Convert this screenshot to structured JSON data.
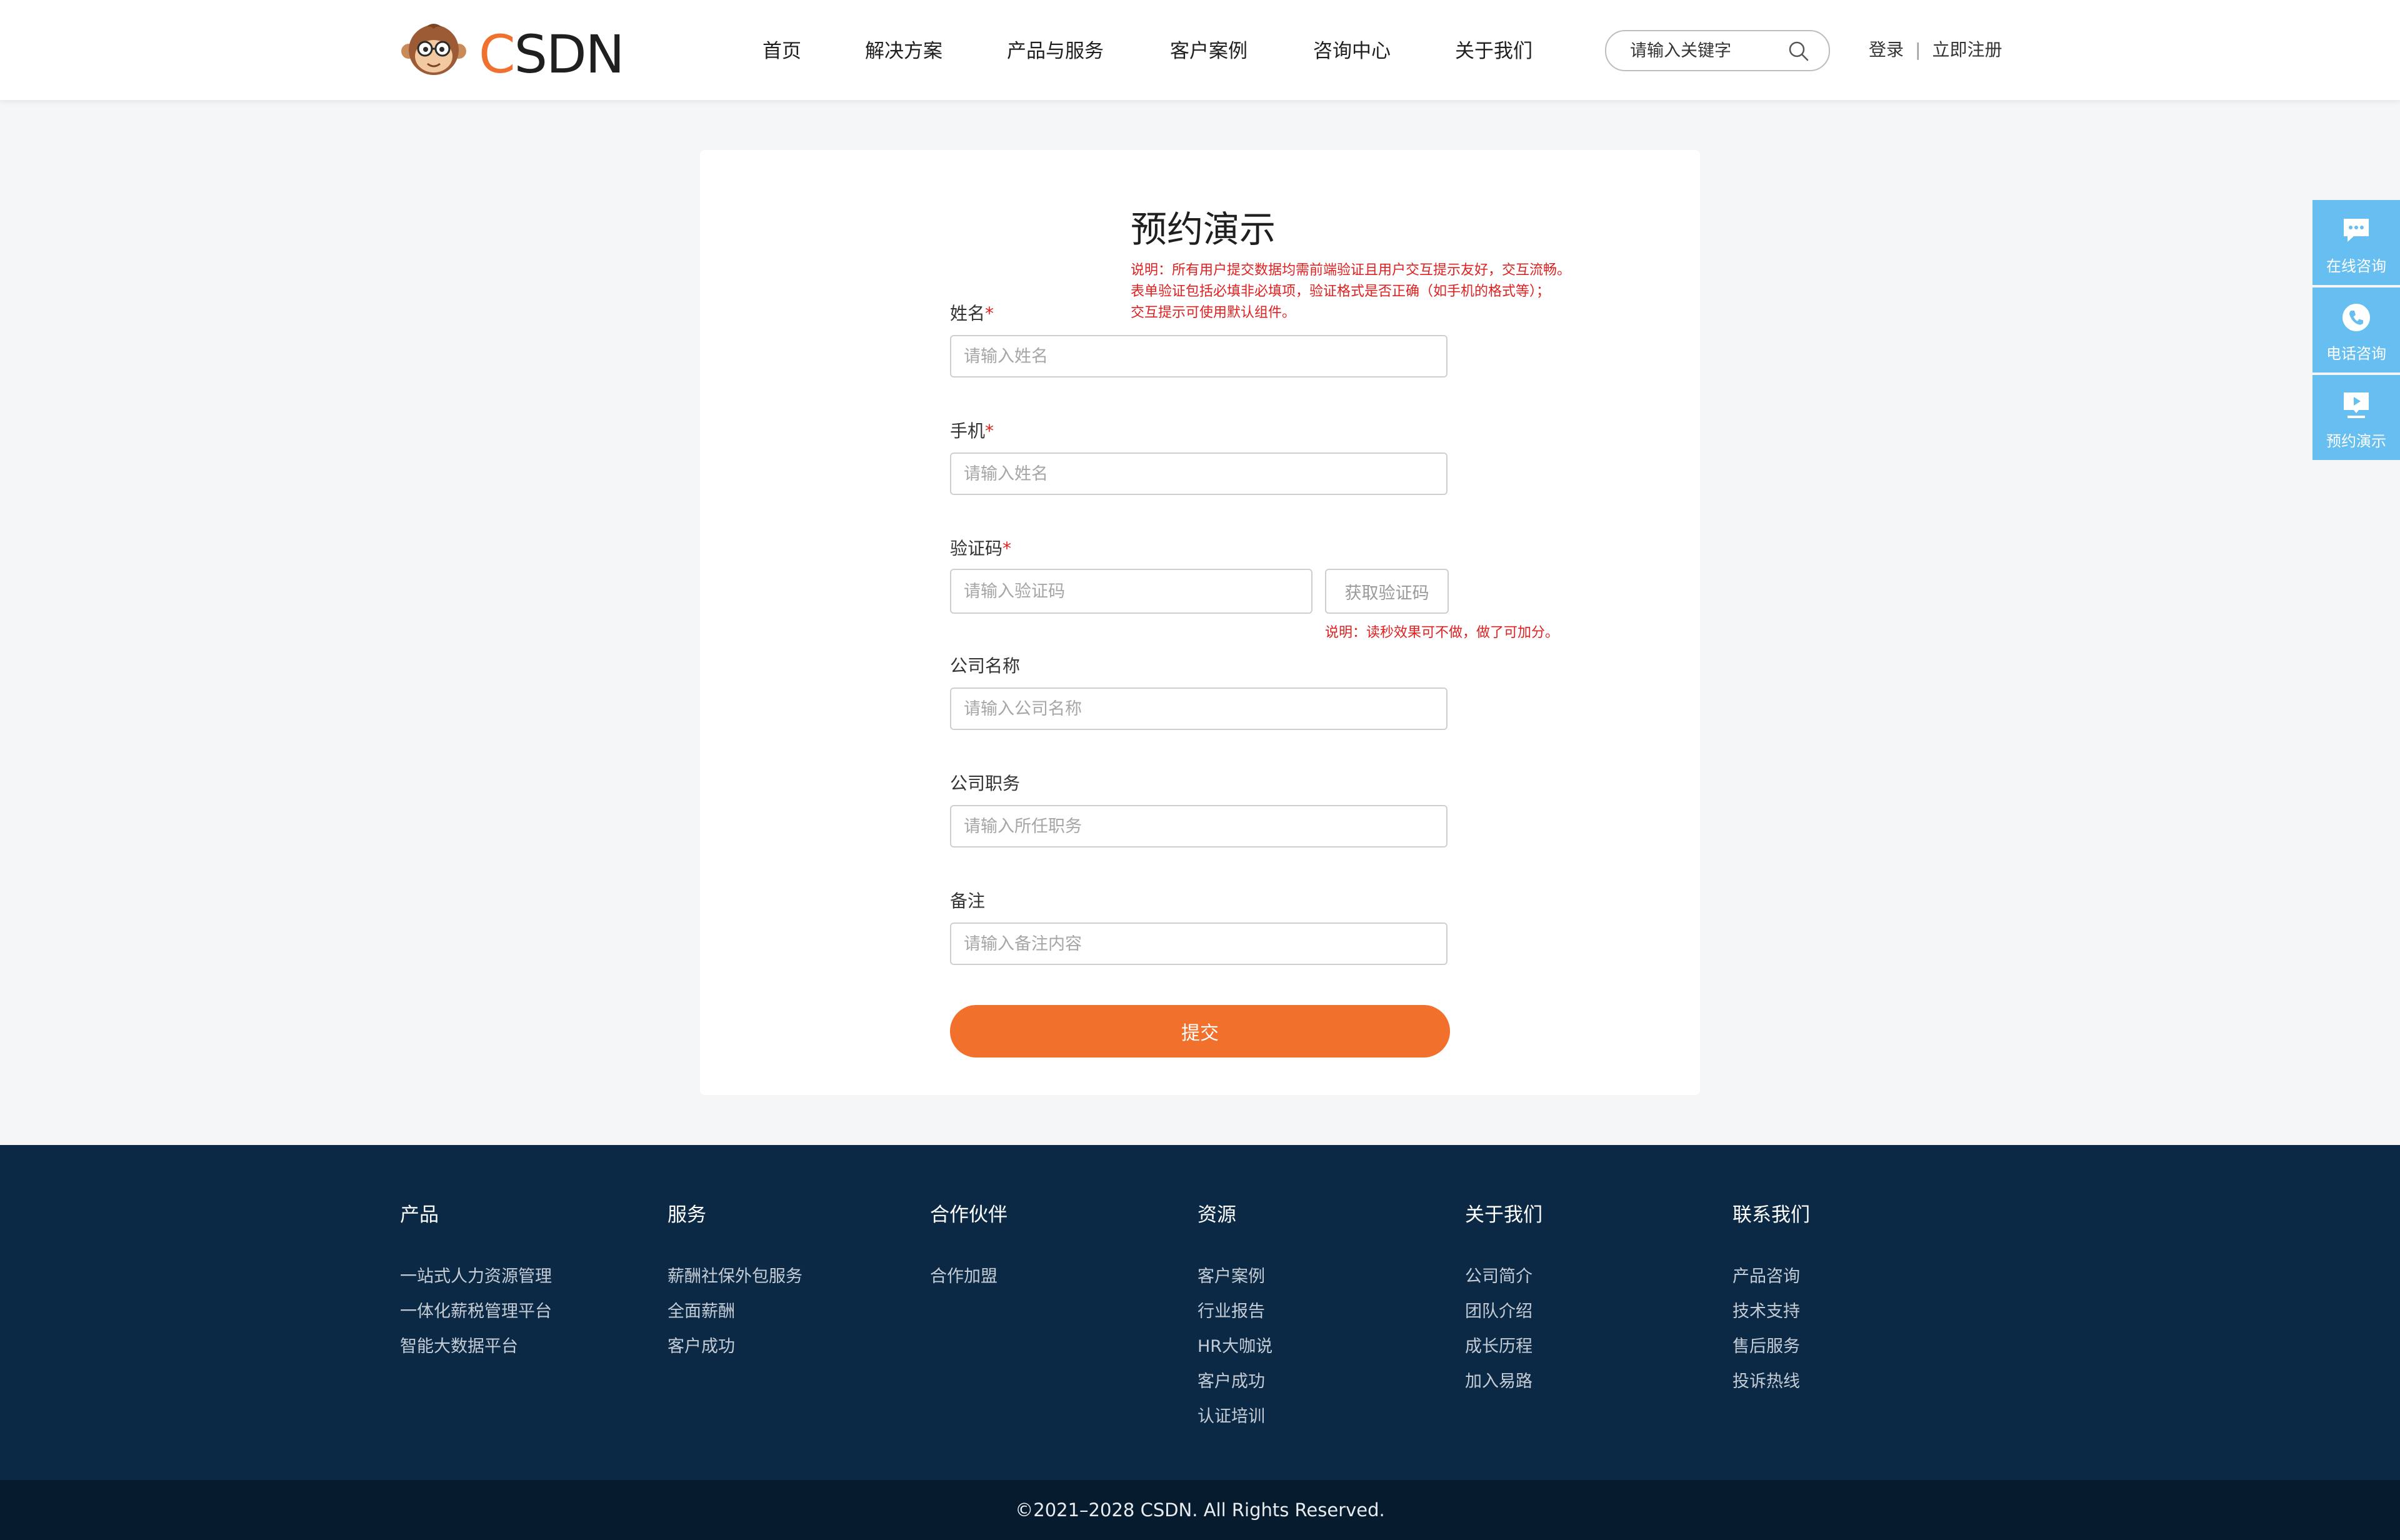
{
  "header": {
    "logo": {
      "c": "C",
      "rest": "SDN"
    },
    "nav": [
      "首页",
      "解决方案",
      "产品与服务",
      "客户案例",
      "咨询中心",
      "关于我们"
    ],
    "search_placeholder": "请输入关键字",
    "login": "登录",
    "separator": "|",
    "register": "立即注册"
  },
  "form": {
    "title": "预约演示",
    "top_note": [
      "说明：所有用户提交数据均需前端验证且用户交互提示友好，交互流畅。",
      "表单验证包括必填非必填项，验证格式是否正确（如手机的格式等）；",
      "交互提示可使用默认组件。"
    ],
    "required_mark": "*",
    "name": {
      "label": "姓名",
      "placeholder": "请输入姓名"
    },
    "phone": {
      "label": "手机",
      "placeholder": "请输入姓名"
    },
    "code": {
      "label": "验证码",
      "placeholder": "请输入验证码",
      "button": "获取验证码",
      "note": "说明：读秒效果可不做，做了可加分。"
    },
    "company": {
      "label": "公司名称",
      "placeholder": "请输入公司名称"
    },
    "position": {
      "label": "公司职务",
      "placeholder": "请输入所任职务"
    },
    "remark": {
      "label": "备注",
      "placeholder": "请输入备注内容"
    },
    "submit": "提交"
  },
  "side_float": [
    {
      "label": "在线咨询",
      "icon": "chat-icon"
    },
    {
      "label": "电话咨询",
      "icon": "phone-icon"
    },
    {
      "label": "预约演示",
      "icon": "presentation-icon"
    }
  ],
  "footer": {
    "columns": [
      {
        "title": "产品",
        "items": [
          "一站式人力资源管理",
          "一体化薪税管理平台",
          "智能大数据平台"
        ]
      },
      {
        "title": "服务",
        "items": [
          "薪酬社保外包服务",
          "全面薪酬",
          "客户成功"
        ]
      },
      {
        "title": "合作伙伴",
        "items": [
          "合作加盟"
        ]
      },
      {
        "title": "资源",
        "items": [
          "客户案例",
          "行业报告",
          "HR大咖说",
          "客户成功",
          "认证培训"
        ]
      },
      {
        "title": "关于我们",
        "items": [
          "公司简介",
          "团队介绍",
          "成长历程",
          "加入易路"
        ]
      },
      {
        "title": "联系我们",
        "items": [
          "产品咨询",
          "技术支持",
          "售后服务",
          "投诉热线"
        ]
      }
    ],
    "copyright": "©2021–2028 CSDN. All Rights Reserved."
  },
  "colors": {
    "accent": "#f0702c",
    "note_red": "#e02020",
    "float_blue": "#66bff0",
    "footer_bg": "#0b2944",
    "copyright_bg": "#061b2e"
  }
}
